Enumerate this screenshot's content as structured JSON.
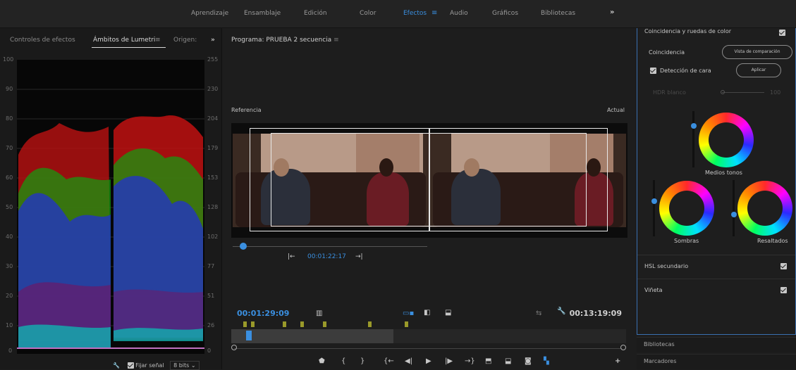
{
  "workspaces": {
    "tabs": [
      "Aprendizaje",
      "Ensamblaje",
      "Edición",
      "Color",
      "Efectos",
      "Audio",
      "Gráficos",
      "Bibliotecas"
    ],
    "active": "Efectos",
    "more": "»"
  },
  "left_panel": {
    "tabs": [
      "Controles de efectos",
      "Ámbitos de Lumetri",
      "Origen:"
    ],
    "menu_icon": "≡",
    "more": "»",
    "scale_left": [
      "100",
      "90",
      "80",
      "70",
      "60",
      "50",
      "40",
      "30",
      "20",
      "10",
      "0"
    ],
    "scale_right": [
      "255",
      "230",
      "204",
      "179",
      "153",
      "128",
      "102",
      "77",
      "51",
      "26",
      "0"
    ],
    "fix_signal_label": "Fijar señal",
    "bits_value": "8 bits",
    "colors": {
      "red": "#e02020",
      "green": "#20c020",
      "blue": "#2030e0",
      "cyan": "#10c0c0"
    }
  },
  "program": {
    "title": "Programa: PRUEBA 2 secuencia",
    "menu_icon": "≡",
    "reference_label": "Referencia",
    "current_label": "Actual",
    "reference_timecode": "00:01:22:17",
    "timecode_current": "00:01:29:09",
    "timecode_duration": "00:13:19:09"
  },
  "lumetri": {
    "section_title": "Coincidencia y ruedas de color",
    "match_label": "Coincidencia",
    "compare_view_button": "Vista de comparación",
    "face_detection_label": "Detección de cara",
    "apply_button": "Aplicar",
    "hdr_label": "HDR blanco",
    "hdr_value": "100",
    "wheels": [
      "Medios tonos",
      "Sombras",
      "Resaltados"
    ],
    "hsl_label": "HSL secundario",
    "vignette_label": "Viñeta"
  },
  "bottom_panels": [
    "Bibliotecas",
    "Marcadores"
  ],
  "accent_color": "#3a8fe0"
}
